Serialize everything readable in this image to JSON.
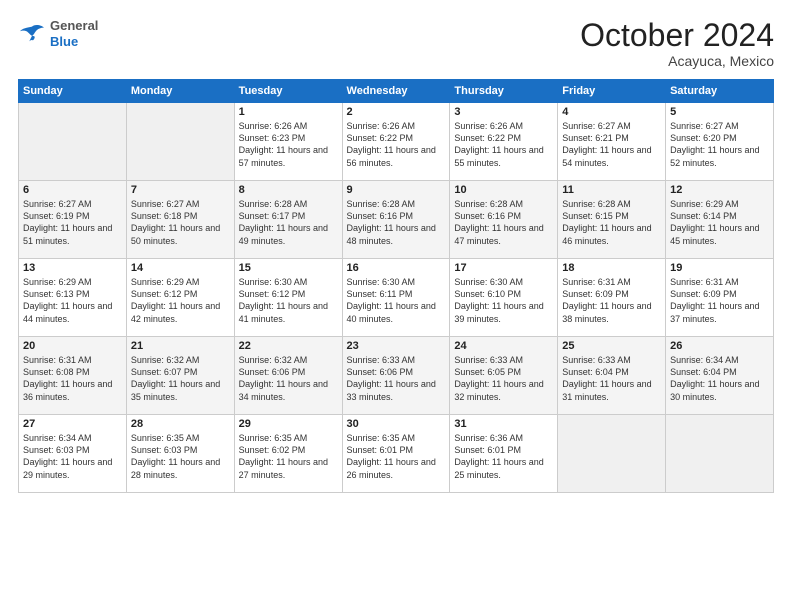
{
  "header": {
    "logo": {
      "general": "General",
      "blue": "Blue"
    },
    "month": "October 2024",
    "location": "Acayuca, Mexico"
  },
  "days_of_week": [
    "Sunday",
    "Monday",
    "Tuesday",
    "Wednesday",
    "Thursday",
    "Friday",
    "Saturday"
  ],
  "weeks": [
    [
      {
        "day": "",
        "sunrise": "",
        "sunset": "",
        "daylight": ""
      },
      {
        "day": "",
        "sunrise": "",
        "sunset": "",
        "daylight": ""
      },
      {
        "day": "1",
        "sunrise": "Sunrise: 6:26 AM",
        "sunset": "Sunset: 6:23 PM",
        "daylight": "Daylight: 11 hours and 57 minutes."
      },
      {
        "day": "2",
        "sunrise": "Sunrise: 6:26 AM",
        "sunset": "Sunset: 6:22 PM",
        "daylight": "Daylight: 11 hours and 56 minutes."
      },
      {
        "day": "3",
        "sunrise": "Sunrise: 6:26 AM",
        "sunset": "Sunset: 6:22 PM",
        "daylight": "Daylight: 11 hours and 55 minutes."
      },
      {
        "day": "4",
        "sunrise": "Sunrise: 6:27 AM",
        "sunset": "Sunset: 6:21 PM",
        "daylight": "Daylight: 11 hours and 54 minutes."
      },
      {
        "day": "5",
        "sunrise": "Sunrise: 6:27 AM",
        "sunset": "Sunset: 6:20 PM",
        "daylight": "Daylight: 11 hours and 52 minutes."
      }
    ],
    [
      {
        "day": "6",
        "sunrise": "Sunrise: 6:27 AM",
        "sunset": "Sunset: 6:19 PM",
        "daylight": "Daylight: 11 hours and 51 minutes."
      },
      {
        "day": "7",
        "sunrise": "Sunrise: 6:27 AM",
        "sunset": "Sunset: 6:18 PM",
        "daylight": "Daylight: 11 hours and 50 minutes."
      },
      {
        "day": "8",
        "sunrise": "Sunrise: 6:28 AM",
        "sunset": "Sunset: 6:17 PM",
        "daylight": "Daylight: 11 hours and 49 minutes."
      },
      {
        "day": "9",
        "sunrise": "Sunrise: 6:28 AM",
        "sunset": "Sunset: 6:16 PM",
        "daylight": "Daylight: 11 hours and 48 minutes."
      },
      {
        "day": "10",
        "sunrise": "Sunrise: 6:28 AM",
        "sunset": "Sunset: 6:16 PM",
        "daylight": "Daylight: 11 hours and 47 minutes."
      },
      {
        "day": "11",
        "sunrise": "Sunrise: 6:28 AM",
        "sunset": "Sunset: 6:15 PM",
        "daylight": "Daylight: 11 hours and 46 minutes."
      },
      {
        "day": "12",
        "sunrise": "Sunrise: 6:29 AM",
        "sunset": "Sunset: 6:14 PM",
        "daylight": "Daylight: 11 hours and 45 minutes."
      }
    ],
    [
      {
        "day": "13",
        "sunrise": "Sunrise: 6:29 AM",
        "sunset": "Sunset: 6:13 PM",
        "daylight": "Daylight: 11 hours and 44 minutes."
      },
      {
        "day": "14",
        "sunrise": "Sunrise: 6:29 AM",
        "sunset": "Sunset: 6:12 PM",
        "daylight": "Daylight: 11 hours and 42 minutes."
      },
      {
        "day": "15",
        "sunrise": "Sunrise: 6:30 AM",
        "sunset": "Sunset: 6:12 PM",
        "daylight": "Daylight: 11 hours and 41 minutes."
      },
      {
        "day": "16",
        "sunrise": "Sunrise: 6:30 AM",
        "sunset": "Sunset: 6:11 PM",
        "daylight": "Daylight: 11 hours and 40 minutes."
      },
      {
        "day": "17",
        "sunrise": "Sunrise: 6:30 AM",
        "sunset": "Sunset: 6:10 PM",
        "daylight": "Daylight: 11 hours and 39 minutes."
      },
      {
        "day": "18",
        "sunrise": "Sunrise: 6:31 AM",
        "sunset": "Sunset: 6:09 PM",
        "daylight": "Daylight: 11 hours and 38 minutes."
      },
      {
        "day": "19",
        "sunrise": "Sunrise: 6:31 AM",
        "sunset": "Sunset: 6:09 PM",
        "daylight": "Daylight: 11 hours and 37 minutes."
      }
    ],
    [
      {
        "day": "20",
        "sunrise": "Sunrise: 6:31 AM",
        "sunset": "Sunset: 6:08 PM",
        "daylight": "Daylight: 11 hours and 36 minutes."
      },
      {
        "day": "21",
        "sunrise": "Sunrise: 6:32 AM",
        "sunset": "Sunset: 6:07 PM",
        "daylight": "Daylight: 11 hours and 35 minutes."
      },
      {
        "day": "22",
        "sunrise": "Sunrise: 6:32 AM",
        "sunset": "Sunset: 6:06 PM",
        "daylight": "Daylight: 11 hours and 34 minutes."
      },
      {
        "day": "23",
        "sunrise": "Sunrise: 6:33 AM",
        "sunset": "Sunset: 6:06 PM",
        "daylight": "Daylight: 11 hours and 33 minutes."
      },
      {
        "day": "24",
        "sunrise": "Sunrise: 6:33 AM",
        "sunset": "Sunset: 6:05 PM",
        "daylight": "Daylight: 11 hours and 32 minutes."
      },
      {
        "day": "25",
        "sunrise": "Sunrise: 6:33 AM",
        "sunset": "Sunset: 6:04 PM",
        "daylight": "Daylight: 11 hours and 31 minutes."
      },
      {
        "day": "26",
        "sunrise": "Sunrise: 6:34 AM",
        "sunset": "Sunset: 6:04 PM",
        "daylight": "Daylight: 11 hours and 30 minutes."
      }
    ],
    [
      {
        "day": "27",
        "sunrise": "Sunrise: 6:34 AM",
        "sunset": "Sunset: 6:03 PM",
        "daylight": "Daylight: 11 hours and 29 minutes."
      },
      {
        "day": "28",
        "sunrise": "Sunrise: 6:35 AM",
        "sunset": "Sunset: 6:03 PM",
        "daylight": "Daylight: 11 hours and 28 minutes."
      },
      {
        "day": "29",
        "sunrise": "Sunrise: 6:35 AM",
        "sunset": "Sunset: 6:02 PM",
        "daylight": "Daylight: 11 hours and 27 minutes."
      },
      {
        "day": "30",
        "sunrise": "Sunrise: 6:35 AM",
        "sunset": "Sunset: 6:01 PM",
        "daylight": "Daylight: 11 hours and 26 minutes."
      },
      {
        "day": "31",
        "sunrise": "Sunrise: 6:36 AM",
        "sunset": "Sunset: 6:01 PM",
        "daylight": "Daylight: 11 hours and 25 minutes."
      },
      {
        "day": "",
        "sunrise": "",
        "sunset": "",
        "daylight": ""
      },
      {
        "day": "",
        "sunrise": "",
        "sunset": "",
        "daylight": ""
      }
    ]
  ]
}
